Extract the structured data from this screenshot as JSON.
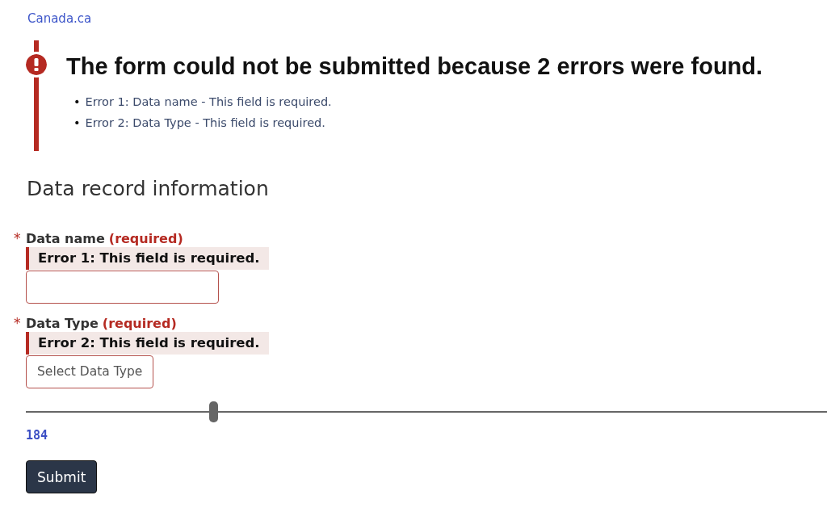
{
  "header_link": "Canada.ca",
  "error_summary": {
    "title": "The form could not be submitted because 2 errors were found.",
    "errors": [
      {
        "bullet": "•",
        "text": "Error 1: Data name - This field is required."
      },
      {
        "bullet": "•",
        "text": "Error 2: Data Type - This field is required."
      }
    ]
  },
  "section_title": "Data record information",
  "fields": [
    {
      "kind": "text",
      "marker": "*",
      "label": "Data name",
      "required_text": "(required)",
      "error": "Error 1: This field is required."
    },
    {
      "kind": "select",
      "marker": "*",
      "label": "Data Type",
      "required_text": "(required)",
      "error": "Error 2: This field is required.",
      "value": "Select Data Type"
    }
  ],
  "slider": {
    "level": 0.234,
    "reading": "184"
  },
  "submit_button": "Submit"
}
